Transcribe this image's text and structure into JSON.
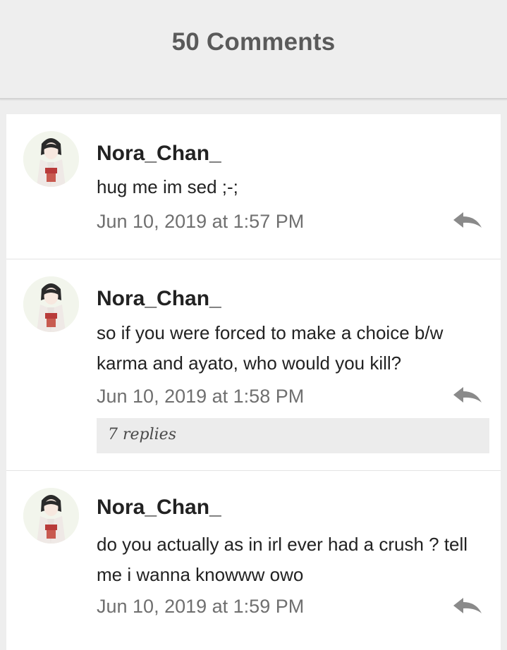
{
  "header": {
    "title": "50 Comments"
  },
  "comments": [
    {
      "username": "Nora_Chan_",
      "text": "hug me im sed ;-;",
      "time": "Jun 10, 2019 at 1:57 PM",
      "avatar_icon": "anime-girl-kimono-avatar",
      "reply_icon": "reply-arrow-icon"
    },
    {
      "username": "Nora_Chan_",
      "text": "so if you were forced to make a choice b/w karma and ayato, who would you kill?",
      "time": "Jun 10, 2019 at 1:58 PM",
      "replies_label": "7 replies",
      "avatar_icon": "anime-girl-kimono-avatar",
      "reply_icon": "reply-arrow-icon"
    },
    {
      "username": "Nora_Chan_",
      "text": "do you actually as in irl ever had a crush ? tell me i wanna knowww owo",
      "time": "Jun 10, 2019 at 1:59 PM",
      "avatar_icon": "anime-girl-kimono-avatar",
      "reply_icon": "reply-arrow-icon"
    }
  ],
  "colors": {
    "background": "#eeeeee",
    "card": "#ffffff",
    "title": "#5a5a5a",
    "username": "#222222",
    "timestamp": "#6f6f6f",
    "replies_bg": "#ececec"
  }
}
